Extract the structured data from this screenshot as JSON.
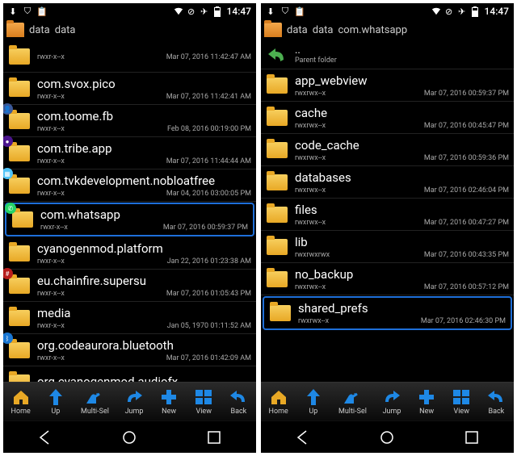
{
  "status": {
    "time": "14:47"
  },
  "toolbar": {
    "home": "Home",
    "up": "Up",
    "multisel": "Multi-Sel",
    "jump": "Jump",
    "new": "New",
    "view": "View",
    "back": "Back"
  },
  "left": {
    "breadcrumb": [
      "data",
      "data"
    ],
    "items": [
      {
        "name": "",
        "perm": "rwxr-x--x",
        "date": "Mar 07, 2016 11:42:47 AM",
        "badge": "",
        "bcolor": ""
      },
      {
        "name": "com.svox.pico",
        "perm": "rwxr-x--x",
        "date": "Mar 07, 2016 11:42:41 AM",
        "badge": "",
        "bcolor": ""
      },
      {
        "name": "com.toome.fb",
        "perm": "rwxr-x--x",
        "date": "Feb 08, 2016 00:19:00 PM",
        "badge": "👤",
        "bcolor": "#3b5998"
      },
      {
        "name": "com.tribe.app",
        "perm": "rwxr-x--x",
        "date": "Mar 07, 2016 11:44:44 AM",
        "badge": "●",
        "bcolor": "#4a148c"
      },
      {
        "name": "com.tvkdevelopment.nobloatfree",
        "perm": "rwxr-x--x",
        "date": "Mar 04, 2016 03:00:05 PM",
        "badge": "▦",
        "bcolor": "#4fc3f7"
      },
      {
        "name": "com.whatsapp",
        "perm": "rwxr-x--x",
        "date": "Mar 07, 2016 00:59:37 PM",
        "badge": "✆",
        "bcolor": "#25d366",
        "hl": true
      },
      {
        "name": "cyanogenmod.platform",
        "perm": "rwxr-x--x",
        "date": "Jan 22, 2016 01:23:38 AM",
        "badge": "",
        "bcolor": ""
      },
      {
        "name": "eu.chainfire.supersu",
        "perm": "rwxr-x--x",
        "date": "Mar 07, 2016 01:05:43 PM",
        "badge": "#",
        "bcolor": "#b71c1c"
      },
      {
        "name": "media",
        "perm": "rwxr-x--x",
        "date": "Jan 05, 1970 01:11:52 AM",
        "badge": "",
        "bcolor": ""
      },
      {
        "name": "org.codeaurora.bluetooth",
        "perm": "rwxr-x--x",
        "date": "Mar 07, 2016 01:42:09 AM",
        "badge": "ᛒ",
        "bcolor": "#1976d2"
      },
      {
        "name": "org.cyanogenmod.audiofx",
        "perm": "",
        "date": "",
        "badge": "",
        "bcolor": ""
      }
    ]
  },
  "right": {
    "breadcrumb": [
      "data",
      "data",
      "com.whatsapp"
    ],
    "parent": {
      "dots": "..",
      "label": "Parent folder"
    },
    "items": [
      {
        "name": "app_webview",
        "perm": "rwxrwx--x",
        "date": "Mar 07, 2016 00:59:37 PM"
      },
      {
        "name": "cache",
        "perm": "rwxrwx--x",
        "date": "Mar 07, 2016 00:45:47 PM"
      },
      {
        "name": "code_cache",
        "perm": "rwxrwx--x",
        "date": "Mar 07, 2016 00:59:36 PM"
      },
      {
        "name": "databases",
        "perm": "rwxrwx--x",
        "date": "Mar 07, 2016 02:46:04 PM"
      },
      {
        "name": "files",
        "perm": "rwxrwx--x",
        "date": "Mar 07, 2016 00:47:27 PM"
      },
      {
        "name": "lib",
        "perm": "rwxrwxrwx",
        "date": "Mar 07, 2016 00:43:35 PM"
      },
      {
        "name": "no_backup",
        "perm": "rwxrwx--x",
        "date": "Mar 07, 2016 00:57:12 PM"
      },
      {
        "name": "shared_prefs",
        "perm": "rwxrwx--x",
        "date": "Mar 07, 2016 02:46:30 PM",
        "hl": true
      }
    ]
  }
}
